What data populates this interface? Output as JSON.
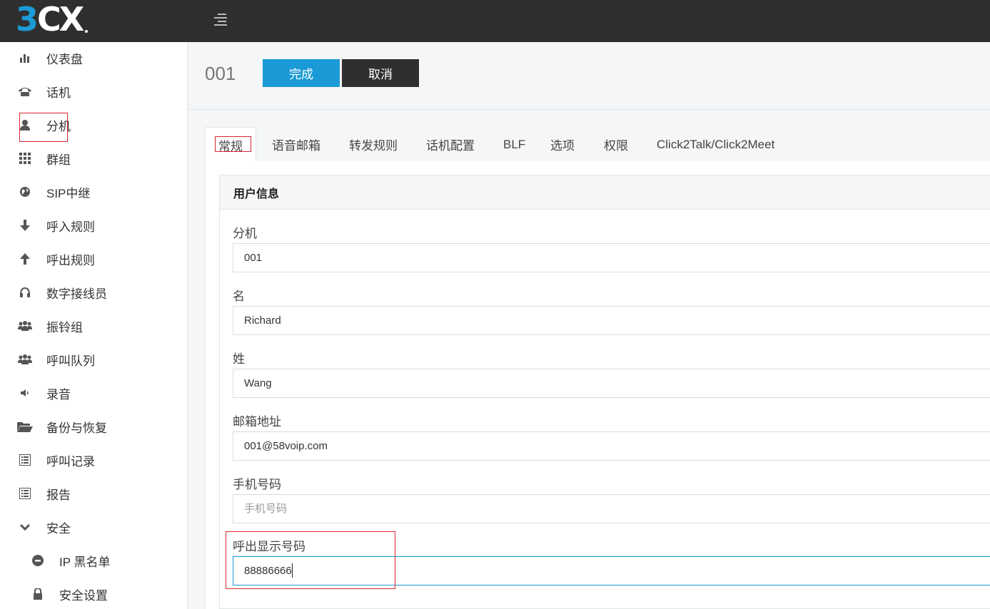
{
  "app": {
    "logo_main": "3",
    "logo_rest": "CX"
  },
  "sidebar": {
    "items": [
      {
        "label": "仪表盘",
        "icon": "bar-chart-icon"
      },
      {
        "label": "话机",
        "icon": "phone-icon"
      },
      {
        "label": "分机",
        "icon": "user-icon"
      },
      {
        "label": "群组",
        "icon": "grid-icon"
      },
      {
        "label": "SIP中继",
        "icon": "globe-icon"
      },
      {
        "label": "呼入规则",
        "icon": "arrow-down-icon"
      },
      {
        "label": "呼出规则",
        "icon": "arrow-up-icon"
      },
      {
        "label": "数字接线员",
        "icon": "headset-icon"
      },
      {
        "label": "振铃组",
        "icon": "users-icon"
      },
      {
        "label": "呼叫队列",
        "icon": "users-icon"
      },
      {
        "label": "录音",
        "icon": "speaker-icon"
      },
      {
        "label": "备份与恢复",
        "icon": "folder-open-icon"
      },
      {
        "label": "呼叫记录",
        "icon": "list-icon"
      },
      {
        "label": "报告",
        "icon": "list-icon"
      },
      {
        "label": "安全",
        "icon": "chevron-down-icon"
      },
      {
        "label": "IP 黑名单",
        "icon": "minus-circle-icon"
      },
      {
        "label": "安全设置",
        "icon": "lock-icon"
      }
    ]
  },
  "header": {
    "title": "001",
    "done_label": "完成",
    "cancel_label": "取消"
  },
  "tabs": [
    {
      "label": "常规"
    },
    {
      "label": "语音邮箱"
    },
    {
      "label": "转发规则"
    },
    {
      "label": "话机配置"
    },
    {
      "label": "BLF"
    },
    {
      "label": "选项"
    },
    {
      "label": "权限"
    },
    {
      "label": "Click2Talk/Click2Meet"
    }
  ],
  "user_info": {
    "heading": "用户信息",
    "fields": [
      {
        "label": "分机",
        "value": "001",
        "placeholder": ""
      },
      {
        "label": "名",
        "value": "Richard",
        "placeholder": ""
      },
      {
        "label": "姓",
        "value": "Wang",
        "placeholder": ""
      },
      {
        "label": "邮箱地址",
        "value": "001@58voip.com",
        "placeholder": ""
      },
      {
        "label": "手机号码",
        "value": "",
        "placeholder": "手机号码"
      },
      {
        "label": "呼出显示号码",
        "value": "88886666",
        "placeholder": ""
      }
    ]
  },
  "colors": {
    "accent": "#1a9ad6",
    "topbar": "#2f2f2f",
    "highlight": "#d9262e"
  }
}
